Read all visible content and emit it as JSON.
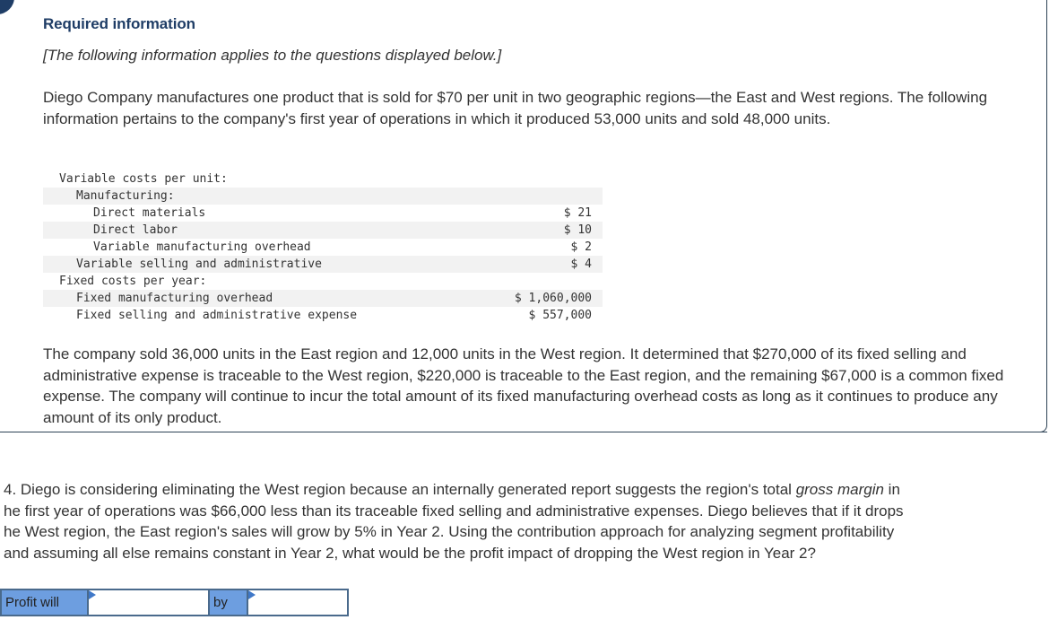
{
  "header": {
    "title": "Required information",
    "note": "[The following information applies to the questions displayed below.]"
  },
  "intro_paragraph": "Diego Company manufactures one product that is sold for $70 per unit in two geographic regions—the East and West regions. The following information pertains to the company's first year of operations in which it produced 53,000 units and sold 48,000 units.",
  "cost_table": {
    "rows": [
      {
        "label": "Variable costs per unit:",
        "amount": "",
        "indent": 0
      },
      {
        "label": "Manufacturing:",
        "amount": "",
        "indent": 1
      },
      {
        "label": "Direct materials",
        "amount": "$ 21",
        "indent": 2
      },
      {
        "label": "Direct labor",
        "amount": "$ 10",
        "indent": 2
      },
      {
        "label": "Variable manufacturing overhead",
        "amount": "$ 2",
        "indent": 2
      },
      {
        "label": "Variable selling and administrative",
        "amount": "$ 4",
        "indent": 1
      },
      {
        "label": "Fixed costs per year:",
        "amount": "",
        "indent": 0
      },
      {
        "label": "Fixed manufacturing overhead",
        "amount": "$ 1,060,000",
        "indent": 1
      },
      {
        "label": "Fixed selling and administrative expense",
        "amount": "$ 557,000",
        "indent": 1
      }
    ]
  },
  "second_paragraph": "The company sold 36,000 units in the East region and 12,000 units in the West region. It determined that $270,000 of its fixed selling and administrative expense is traceable to the West region, $220,000 is traceable to the East region, and the remaining $67,000 is a common fixed expense. The company will continue to incur the total amount of its fixed manufacturing overhead costs as long as it continues to produce any amount of its only product.",
  "question": {
    "line1_before": "4. Diego is considering eliminating the West region because an internally generated report suggests the region's total ",
    "line1_italic": "gross margin",
    "line1_after": " in",
    "line2": "he first year of operations was $66,000 less than its traceable fixed selling and administrative expenses. Diego believes that if it drops",
    "line3": "he West region, the East region's sales will grow by 5% in Year 2. Using the contribution approach for analyzing segment profitability",
    "line4": "and assuming all else remains constant in Year 2, what would be the profit impact of dropping the West region in Year 2?"
  },
  "answer": {
    "label_profit": "Profit will",
    "direction_value": "",
    "label_by": "by",
    "amount_value": ""
  },
  "colors": {
    "title": "#1f3d66",
    "answer_label_bg": "#6d9ee0",
    "border": "#2d4255"
  }
}
